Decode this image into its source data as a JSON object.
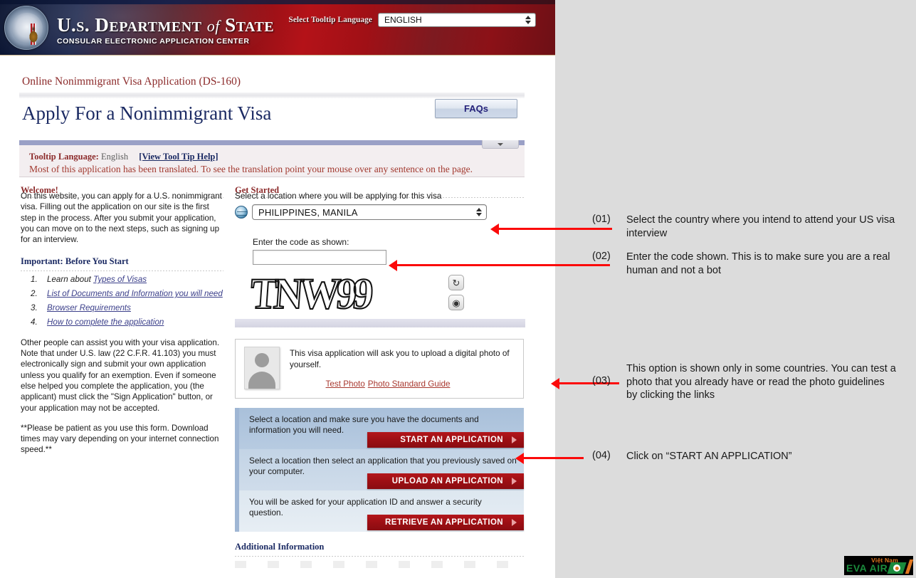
{
  "banner": {
    "department_line1_prefix": "U.S. D",
    "department_title": "U.S. DEPARTMENT of STATE",
    "department_subtitle": "CONSULAR ELECTRONIC APPLICATION CENTER",
    "language_label": "Select Tooltip Language",
    "language_value": "ENGLISH",
    "seal_alt": "us-department-of-state-seal"
  },
  "page": {
    "kicker": "Online Nonimmigrant Visa Application (DS-160)",
    "title": "Apply For a Nonimmigrant Visa",
    "faq_label": "FAQs"
  },
  "tooltip": {
    "label": "Tooltip Language:",
    "value": "English",
    "help_link": "[View Tool Tip Help]",
    "notice": "Most of this application has been translated. To see the translation point your mouse over any sentence on the page."
  },
  "welcome": {
    "heading": "Welcome!",
    "paragraph1": "On this website, you can apply for a U.S. nonimmigrant visa. Filling out the application on our site is the first step in the process. After you submit your application, you can move on to the next steps, such as signing up for an interview.",
    "important_heading": "Important: Before You Start",
    "steps": [
      {
        "num": "1.",
        "prefix": "Learn about ",
        "link": "Types of Visas"
      },
      {
        "num": "2.",
        "prefix": "",
        "link": "List of Documents and Information you will need"
      },
      {
        "num": "3.",
        "prefix": "",
        "link": "Browser Requirements"
      },
      {
        "num": "4.",
        "prefix": "",
        "link": "How to complete the application"
      }
    ],
    "paragraph2": "Other people can assist you with your visa application. Note that under U.S. law (22 C.F.R. 41.103) you must electronically sign and submit your own application unless you qualify for an exemption. Even if someone else helped you complete the application, you (the applicant) must click the \"Sign Application\" button, or your application may not be accepted.",
    "paragraph3": "**Please be patient as you use this form. Download times may vary depending on your internet connection speed.**"
  },
  "get_started": {
    "heading": "Get Started",
    "location_label": "Select a location where you will be applying for this visa",
    "location_value": "PHILIPPINES, MANILA",
    "code_label": "Enter the code as shown:",
    "code_value": "",
    "captcha_text": "TNW99",
    "refresh_icon": "refresh-icon",
    "audio_icon": "audio-icon"
  },
  "photo": {
    "text": "This visa application will ask you to upload a digital photo of yourself.",
    "link_test": "Test Photo",
    "link_guide": "Photo Standard Guide"
  },
  "actions": [
    {
      "text": "Select a location and make sure you have the documents and information you will need.",
      "button": "START AN APPLICATION"
    },
    {
      "text": "Select a location then select an application that you previously saved on your computer.",
      "button": "UPLOAD AN APPLICATION"
    },
    {
      "text": "You will be asked for your application ID and answer a security question.",
      "button": "RETRIEVE AN APPLICATION"
    }
  ],
  "additional": {
    "heading": "Additional Information"
  },
  "annotations": [
    {
      "num": "(01)",
      "text": "Select the country where you intend to attend your US visa interview"
    },
    {
      "num": "(02)",
      "text": "Enter the code shown. This is to make sure you are a real human and not a bot"
    },
    {
      "num": "(03)",
      "text": "This option is shown only in some countries. You can test a photo that you already have or read the photo guidelines by clicking the links"
    },
    {
      "num": "(04)",
      "text": "Click on “START AN APPLICATION”"
    }
  ],
  "watermark": {
    "brand": "EVA AIR",
    "region": "Việt Nam"
  },
  "colors": {
    "banner_red": "#b41218",
    "accent_red": "#9d0f14",
    "heading_red": "#8c2b2b",
    "heading_blue": "#1b2a63",
    "arrow_red": "#fb0a0a",
    "panel_blue": "#a9c0da"
  }
}
